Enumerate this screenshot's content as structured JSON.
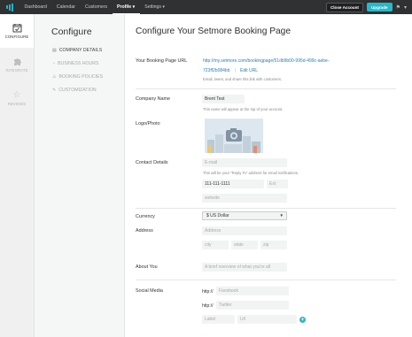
{
  "topnav": {
    "items": [
      {
        "label": "Dashboard"
      },
      {
        "label": "Calendar"
      },
      {
        "label": "Customers"
      },
      {
        "label": "Profile ▾",
        "active": true
      },
      {
        "label": "Settings ▾"
      }
    ],
    "close_account": "Close Account",
    "upgrade": "Upgrade"
  },
  "rail": [
    {
      "label": "CONFIGURE",
      "icon": "calendar-check-icon",
      "active": true
    },
    {
      "label": "INTEGRATE",
      "icon": "puzzle-icon"
    },
    {
      "label": "REVIEWS",
      "icon": "star-icon"
    }
  ],
  "subnav": {
    "title": "Configure",
    "items": [
      {
        "label": "COMPANY DETAILS",
        "icon": "document-icon",
        "active": true
      },
      {
        "label": "BUSINESS HOURS",
        "icon": "clock-icon"
      },
      {
        "label": "BOOKING POLICIES",
        "icon": "warning-icon"
      },
      {
        "label": "CUSTOMIZATION",
        "icon": "palette-icon"
      }
    ]
  },
  "main": {
    "title": "Configure Your Setmore Booking Page",
    "booking_url_label": "Your Booking Page URL",
    "booking_url_line1": "http://my.setmore.com/bookingpage/51db9b00-995d-499c-aebe-",
    "booking_url_line2": "723ff2b084bb",
    "edit_url": "Edit URL",
    "url_hint": "Email, tweet, and share this link with customers.",
    "company_name_label": "Company Name",
    "company_name_value": "Brent Test",
    "company_name_hint": "This name will appear at the top of your account.",
    "logo_label": "Logo/Photo",
    "contact_label": "Contact Details",
    "email_placeholder": "E-mail",
    "email_hint": "This will be your \"Reply To\" address for email notifications.",
    "phone_value": "111-111-1111",
    "ext_placeholder": "Ext",
    "website_placeholder": "website",
    "currency_label": "Currency",
    "currency_value": "$ US Dollar",
    "address_label": "Address",
    "address_placeholder": "Address",
    "city_placeholder": "city",
    "state_placeholder": "state",
    "zip_placeholder": "zip",
    "about_label": "About You",
    "about_placeholder": "A brief overview of what you're all",
    "social_label": "Social Media",
    "http_prefix": "http://",
    "facebook_placeholder": "Facebook",
    "twitter_placeholder": "Twitter",
    "social_label_placeholder": "Label",
    "social_url_placeholder": "Url"
  }
}
